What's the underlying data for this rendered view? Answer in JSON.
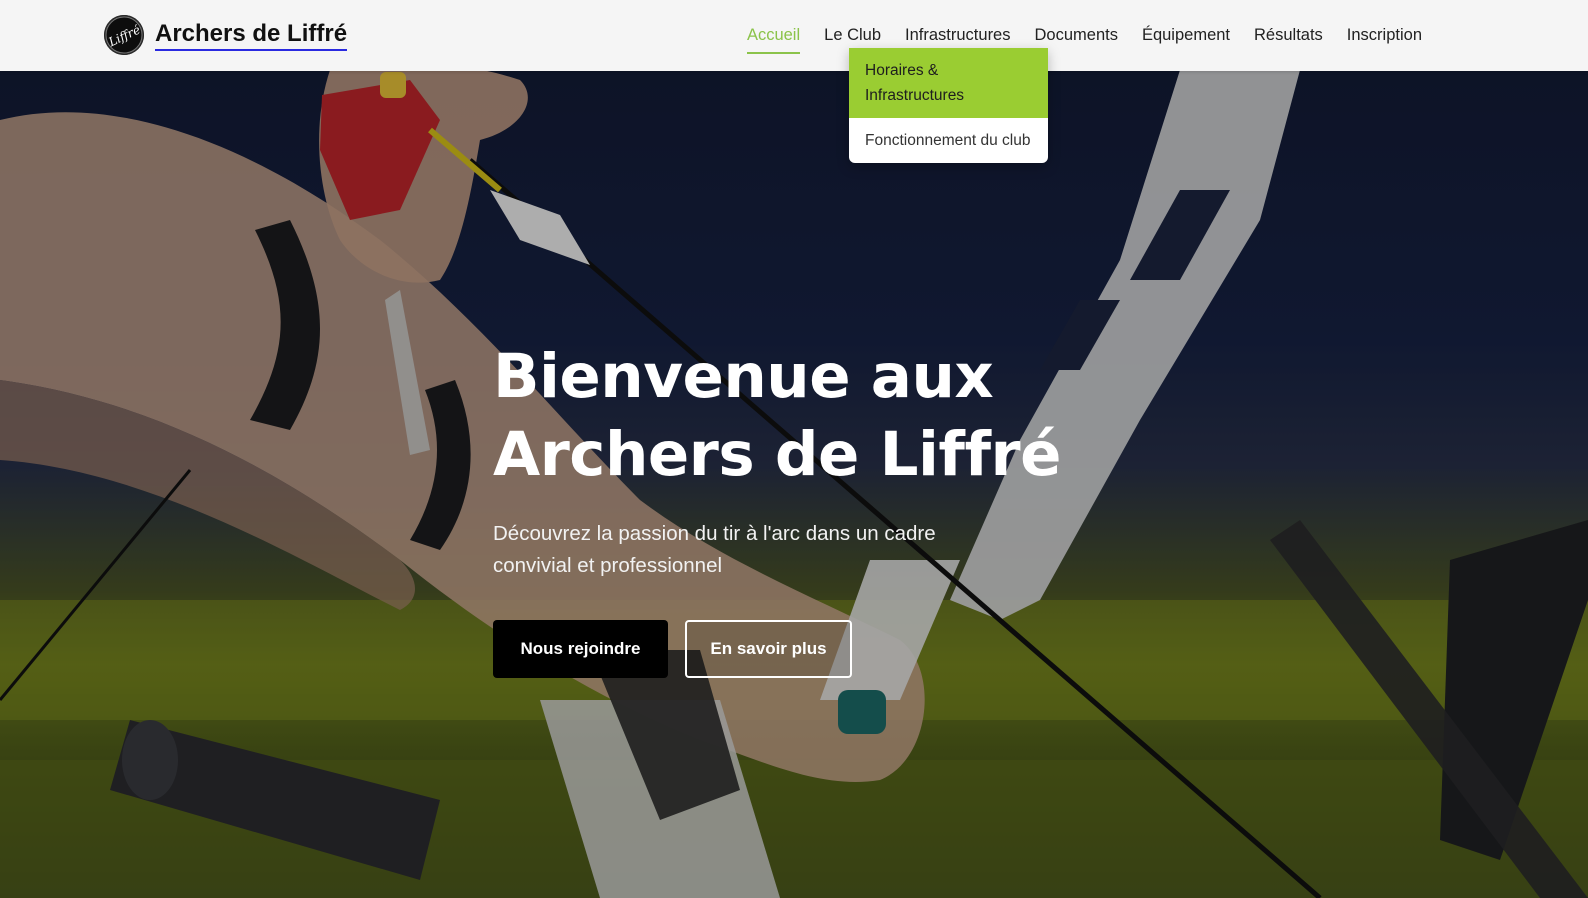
{
  "brand": {
    "name": "Archers de Liffré",
    "logo_text": "Liffré"
  },
  "nav": {
    "items": [
      {
        "label": "Accueil"
      },
      {
        "label": "Le Club"
      },
      {
        "label": "Infrastructures"
      },
      {
        "label": "Documents"
      },
      {
        "label": "Équipement"
      },
      {
        "label": "Résultats"
      },
      {
        "label": "Inscription"
      }
    ],
    "active_index": 0
  },
  "dropdown": {
    "parent": "Le Club",
    "items": [
      {
        "label": "Horaires & Infrastructures"
      },
      {
        "label": "Fonctionnement du club"
      }
    ]
  },
  "hero": {
    "title_line1": "Bienvenue aux",
    "title_line2": "Archers de Liffré",
    "subtitle": "Découvrez la passion du tir à l'arc dans un cadre convivial et professionnel",
    "primary_button": "Nous rejoindre",
    "secondary_button": "En savoir plus",
    "image_icon": "archery-bow-photo"
  },
  "colors": {
    "accent": "#8bc34a",
    "dropdown_highlight": "#9acd32",
    "header_bg": "#f5f5f5",
    "primary_button_bg": "#000000"
  }
}
